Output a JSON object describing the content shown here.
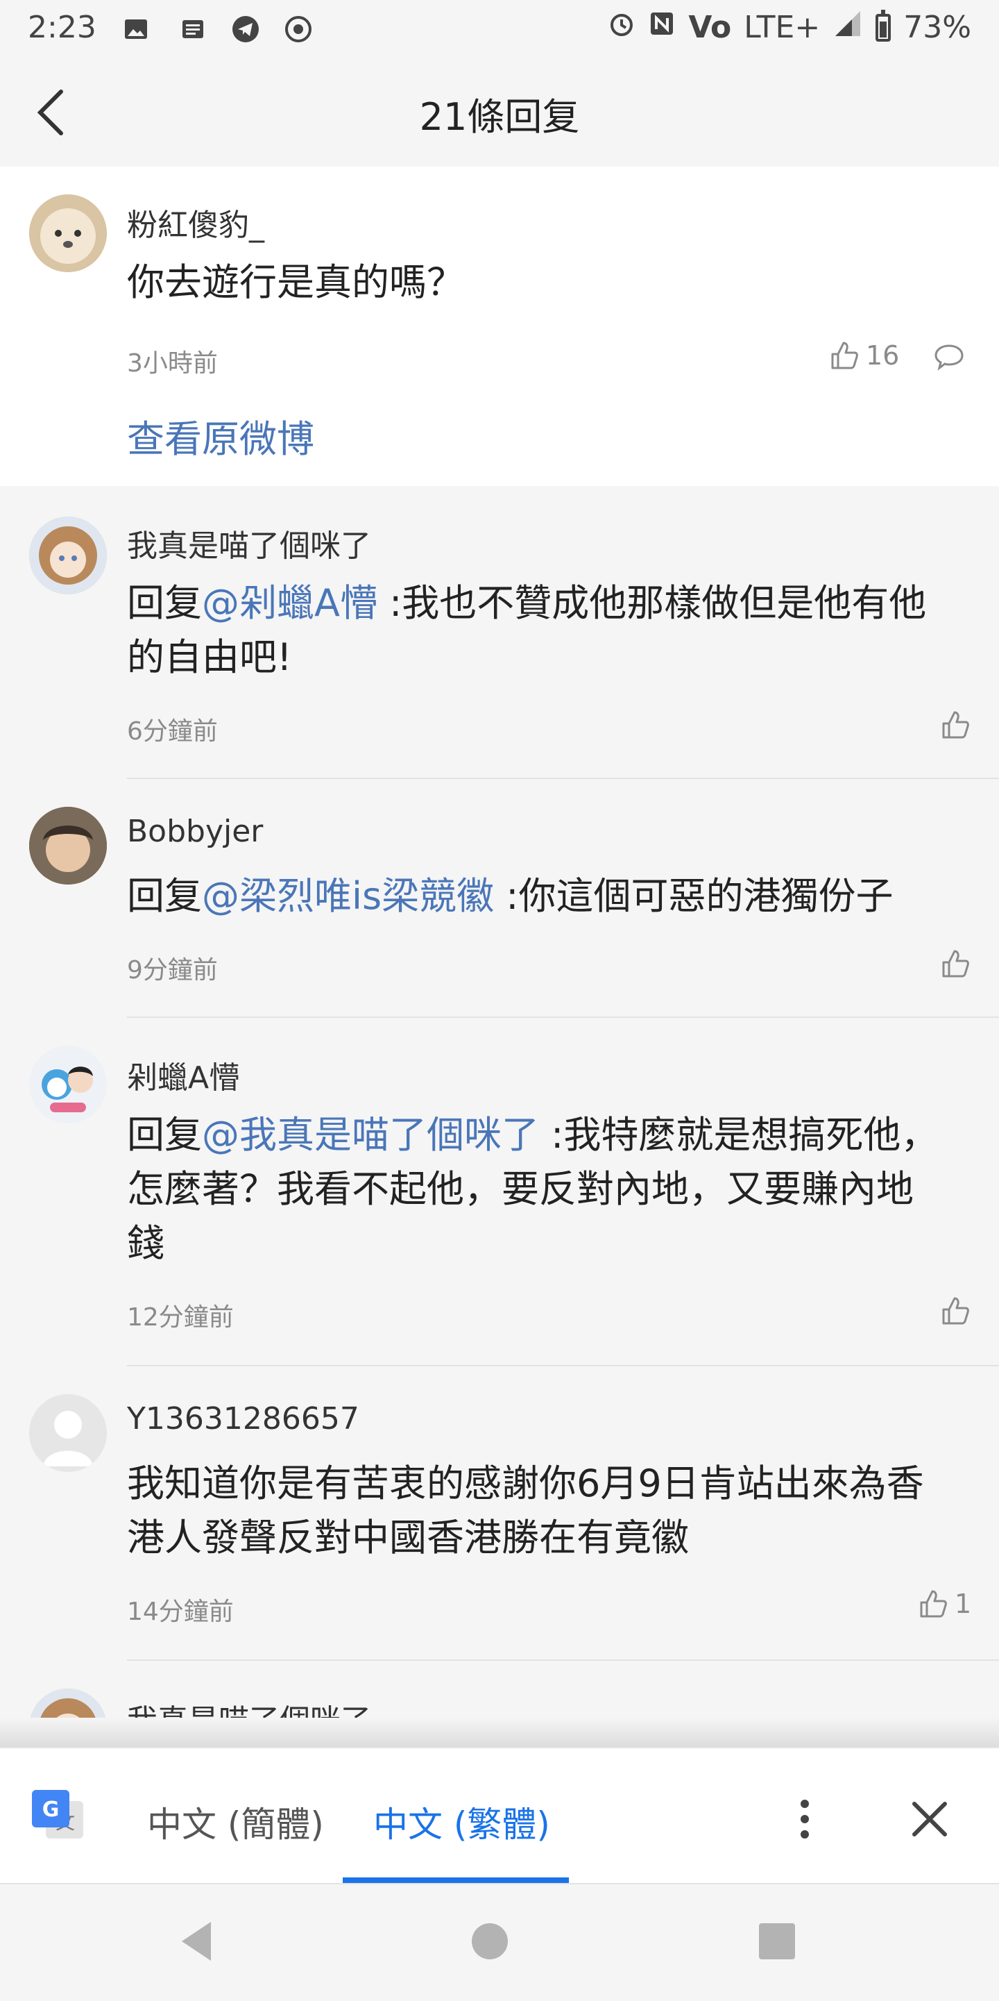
{
  "status": {
    "time": "2:23",
    "network": "LTE+",
    "battery": "73%"
  },
  "header": {
    "title": "21條回复"
  },
  "original": {
    "user": "粉紅傻豹_",
    "text": "你去遊行是真的嗎？",
    "time": "3小時前",
    "likes": "16",
    "view_original": "查看原微博"
  },
  "replies": [
    {
      "user": "我真是喵了個咪了",
      "prefix": "回复",
      "mention": "@剁蠟A懵",
      "body_line1": " :我也不贊成他那樣做但是他有他",
      "body_line2": "的自由吧!",
      "time": "6分鐘前",
      "likes": ""
    },
    {
      "user": "Bobbyjer",
      "prefix": "回复",
      "mention": "@梁烈唯is梁競徽",
      "body_line1": " :你這個可惡的港獨份子",
      "time": "9分鐘前",
      "likes": ""
    },
    {
      "user": "剁蠟A懵",
      "prefix": "回复",
      "mention": "@我真是喵了個咪了",
      "body_line1": " :我特麼就是想搞死他，",
      "body_line2": "怎麼著？我看不起他，要反對內地，又要賺內地",
      "body_line3": "錢",
      "time": "12分鐘前",
      "likes": ""
    },
    {
      "user": "Y13631286657",
      "body_line1": "我知道你是有苦衷的感謝你6月9日肯站出來為香",
      "body_line2": "港人發聲反對中國香港勝在有竟徽",
      "time": "14分鐘前",
      "likes": "1"
    },
    {
      "user": "我真是喵了個咪了"
    }
  ],
  "translate": {
    "option_simplified": "中文 (簡體)",
    "option_traditional": "中文 (繁體)"
  },
  "colors": {
    "link": "#4a76b8",
    "translate_accent": "#1a73e8"
  }
}
